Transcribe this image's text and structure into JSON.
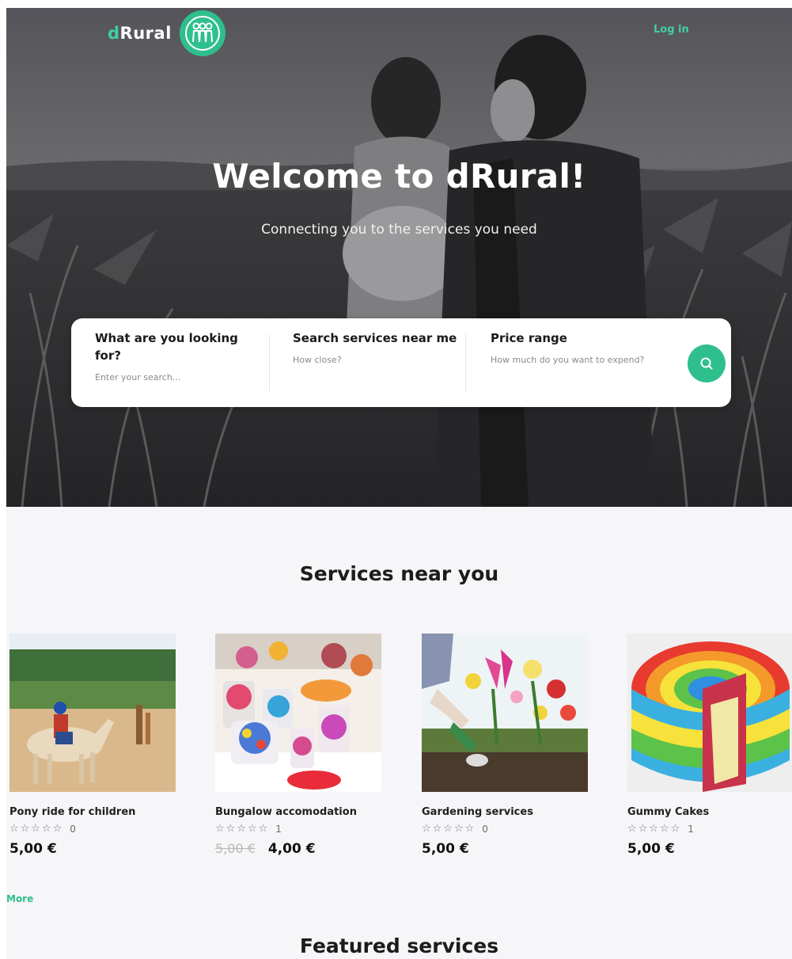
{
  "header": {
    "logo_text_prefix": "d",
    "logo_text_rest": "Rural",
    "login_label": "Log in"
  },
  "hero": {
    "title": "Welcome to dRural!",
    "subtitle": "Connecting you to the services you need"
  },
  "search": {
    "what_label": "What are you looking for?",
    "what_placeholder": "Enter your search...",
    "near_label": "Search services near me",
    "near_hint": "How close?",
    "price_label": "Price range",
    "price_hint": "How much do you want to expend?"
  },
  "services_near": {
    "title": "Services near you",
    "more_label": "More",
    "items": [
      {
        "name": "Pony ride for children",
        "stars": "☆☆☆☆☆",
        "rating_count": "0",
        "price": "5,00 €",
        "old_price": ""
      },
      {
        "name": "Bungalow accomodation",
        "stars": "☆☆☆☆☆",
        "rating_count": "1",
        "price": "4,00 €",
        "old_price": "5,00 €"
      },
      {
        "name": "Gardening services",
        "stars": "☆☆☆☆☆",
        "rating_count": "0",
        "price": "5,00 €",
        "old_price": ""
      },
      {
        "name": "Gummy Cakes",
        "stars": "☆☆☆☆☆",
        "rating_count": "1",
        "price": "5,00 €",
        "old_price": ""
      }
    ]
  },
  "featured": {
    "title": "Featured services"
  },
  "colors": {
    "accent": "#2fbf8d",
    "hero_dark": "#3b3b3d"
  },
  "icons": {
    "logo": "people-circle-logo",
    "search": "search-icon",
    "star": "star-outline-icon"
  }
}
